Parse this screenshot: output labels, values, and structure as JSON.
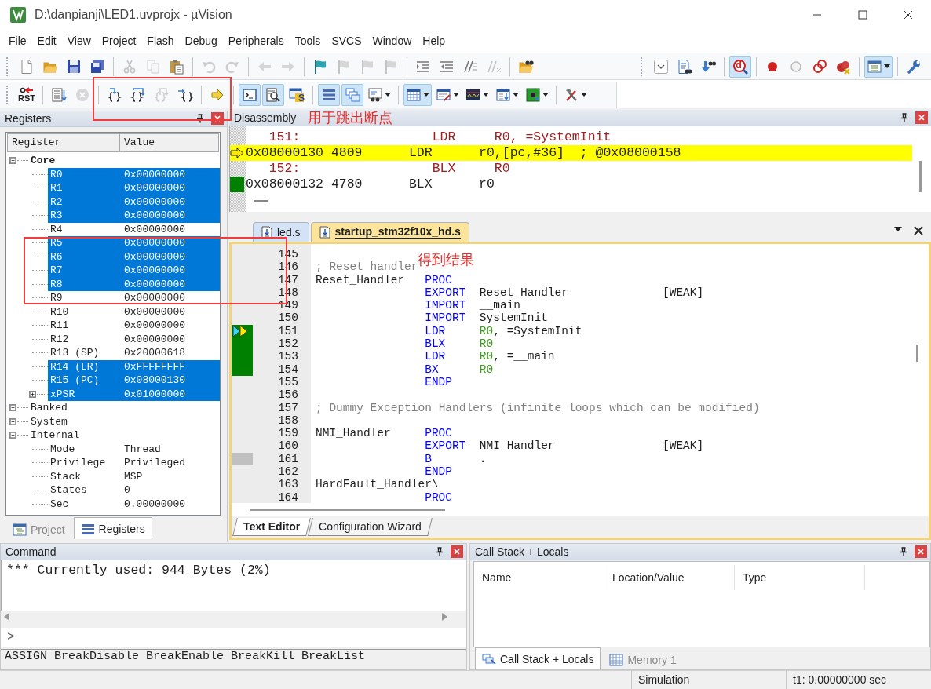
{
  "window": {
    "title": "D:\\danpianji\\LED1.uvprojx - µVision"
  },
  "menu": [
    "File",
    "Edit",
    "View",
    "Project",
    "Flash",
    "Debug",
    "Peripherals",
    "Tools",
    "SVCS",
    "Window",
    "Help"
  ],
  "toolbar_rows": [
    [
      {
        "groups": [
          [
            {
              "disabled": false,
              "pressed": false
            },
            {
              "disabled": false,
              "pressed": false
            },
            {
              "disabled": false,
              "pressed": false
            },
            {
              "disabled": false,
              "pressed": false
            }
          ],
          [
            {
              "disabled": true,
              "pressed": false
            },
            {
              "disabled": true,
              "pressed": false
            },
            {
              "disabled": false,
              "pressed": false
            }
          ],
          [
            {
              "disabled": true,
              "pressed": false
            },
            {
              "disabled": true,
              "pressed": false
            }
          ],
          [
            {
              "disabled": true,
              "pressed": false
            },
            {
              "disabled": true,
              "pressed": false
            }
          ],
          [
            {
              "disabled": false,
              "pressed": false
            },
            {
              "disabled": true,
              "pressed": false
            },
            {
              "disabled": true,
              "pressed": false
            },
            {
              "disabled": true,
              "pressed": false
            }
          ],
          [
            {
              "disabled": false,
              "pressed": false
            },
            {
              "disabled": false,
              "pressed": false
            },
            {
              "disabled": false,
              "pressed": false
            },
            {
              "disabled": true,
              "pressed": false
            }
          ],
          [
            {
              "disabled": false,
              "pressed": false
            }
          ]
        ]
      },
      {
        "groups": [
          [
            {
              "disabled": false,
              "pressed": false
            },
            {
              "disabled": false,
              "pressed": false
            },
            {
              "disabled": false,
              "pressed": false
            }
          ],
          [
            {
              "disabled": false,
              "pressed": true,
              "label": "d"
            }
          ],
          [
            {
              "disabled": false,
              "pressed": false
            },
            {
              "disabled": false,
              "pressed": false
            },
            {
              "disabled": false,
              "pressed": false
            },
            {
              "disabled": false,
              "pressed": false
            }
          ],
          [
            {
              "disabled": false,
              "pressed": true
            }
          ],
          [
            {
              "disabled": false,
              "pressed": false
            }
          ]
        ]
      }
    ],
    [
      {
        "groups": [
          [
            {
              "disabled": false,
              "pressed": false,
              "label": "RST"
            }
          ],
          [
            {
              "disabled": false,
              "pressed": false
            },
            {
              "disabled": true,
              "pressed": false
            }
          ],
          [
            {
              "disabled": false,
              "pressed": false
            },
            {
              "disabled": false,
              "pressed": false
            },
            {
              "disabled": true,
              "pressed": false
            },
            {
              "disabled": false,
              "pressed": false
            }
          ],
          [
            {
              "disabled": false,
              "pressed": false
            }
          ],
          [
            {
              "disabled": false,
              "pressed": true
            },
            {
              "disabled": false,
              "pressed": true
            },
            {
              "disabled": false,
              "pressed": false,
              "label": "S"
            }
          ],
          [
            {
              "disabled": false,
              "pressed": true
            },
            {
              "disabled": false,
              "pressed": true
            },
            {
              "disabled": false,
              "pressed": false
            }
          ],
          [
            {
              "disabled": false,
              "pressed": true
            },
            {
              "disabled": false,
              "pressed": false
            },
            {
              "disabled": false,
              "pressed": false
            },
            {
              "disabled": false,
              "pressed": false
            },
            {
              "disabled": false,
              "pressed": false
            }
          ],
          [
            {
              "disabled": false,
              "pressed": false
            }
          ]
        ]
      }
    ]
  ],
  "registers": {
    "title": "Registers",
    "columns": [
      "Register",
      "Value"
    ],
    "tree": [
      {
        "name": "Core",
        "bold": true,
        "expanded": true,
        "selected": false,
        "children": [
          {
            "name": "R0",
            "value": "0x00000000",
            "selected": true
          },
          {
            "name": "R1",
            "value": "0x00000000",
            "selected": true
          },
          {
            "name": "R2",
            "value": "0x00000000",
            "selected": true
          },
          {
            "name": "R3",
            "value": "0x00000000",
            "selected": true
          },
          {
            "name": "R4",
            "value": "0x00000000",
            "selected": false
          },
          {
            "name": "R5",
            "value": "0x00000000",
            "selected": true
          },
          {
            "name": "R6",
            "value": "0x00000000",
            "selected": true
          },
          {
            "name": "R7",
            "value": "0x00000000",
            "selected": true
          },
          {
            "name": "R8",
            "value": "0x00000000",
            "selected": true
          },
          {
            "name": "R9",
            "value": "0x00000000",
            "selected": false
          },
          {
            "name": "R10",
            "value": "0x00000000",
            "selected": false
          },
          {
            "name": "R11",
            "value": "0x00000000",
            "selected": false
          },
          {
            "name": "R12",
            "value": "0x00000000",
            "selected": false
          },
          {
            "name": "R13 (SP)",
            "value": "0x20000618",
            "selected": false
          },
          {
            "name": "R14 (LR)",
            "value": "0xFFFFFFFF",
            "selected": true
          },
          {
            "name": "R15 (PC)",
            "value": "0x08000130",
            "selected": true
          },
          {
            "name": "xPSR",
            "value": "0x01000000",
            "selected": true,
            "expanded": false
          }
        ]
      },
      {
        "name": "Banked",
        "bold": false,
        "expanded": false,
        "selected": false
      },
      {
        "name": "System",
        "bold": false,
        "expanded": false,
        "selected": false
      },
      {
        "name": "Internal",
        "bold": false,
        "expanded": true,
        "selected": false,
        "children": [
          {
            "name": "Mode",
            "value": "Thread",
            "selected": false
          },
          {
            "name": "Privilege",
            "value": "Privileged",
            "selected": false
          },
          {
            "name": "Stack",
            "value": "MSP",
            "selected": false
          },
          {
            "name": "States",
            "value": "0",
            "selected": false
          },
          {
            "name": "Sec",
            "value": "0.00000000",
            "selected": false
          }
        ]
      }
    ],
    "tabs": [
      {
        "label": "Project",
        "selected": false
      },
      {
        "label": "Registers",
        "selected": true
      }
    ]
  },
  "disassembly": {
    "title": "Disassembly",
    "lines": [
      {
        "kind": "source",
        "label": "151:",
        "mnemonic": "LDR",
        "operands": "R0, =SystemInit"
      },
      {
        "kind": "asm",
        "address": "0x08000130",
        "opcode": "4809",
        "mnemonic": "LDR",
        "operands": "r0,[pc,#36]",
        "comment": "; @0x08000158",
        "current": true
      },
      {
        "kind": "source",
        "label": "152:",
        "mnemonic": "BLX",
        "operands": "R0"
      },
      {
        "kind": "asm",
        "address": "0x08000132",
        "opcode": "4780",
        "mnemonic": "BLX",
        "operands": "r0",
        "current": false
      }
    ]
  },
  "editor": {
    "tabs": [
      {
        "label": "led.s",
        "selected": false
      },
      {
        "label": "startup_stm32f10x_hd.s",
        "selected": true
      }
    ],
    "lines": [
      {
        "number": "145"
      },
      {
        "number": "146",
        "comment": "; Reset handler"
      },
      {
        "number": "147",
        "label": "Reset_Handler",
        "op": "PROC"
      },
      {
        "number": "148",
        "op": "EXPORT",
        "args": [
          {
            "kind": "plain",
            "text": "Reset_Handler"
          }
        ],
        "attr": "[WEAK]"
      },
      {
        "number": "149",
        "op": "IMPORT",
        "args": [
          {
            "kind": "plain",
            "text": "__main"
          }
        ]
      },
      {
        "number": "150",
        "op": "IMPORT",
        "args": [
          {
            "kind": "plain",
            "text": "SystemInit"
          }
        ]
      },
      {
        "number": "151",
        "current": true,
        "executed": true,
        "op": "LDR",
        "args": [
          {
            "kind": "register",
            "text": "R0"
          },
          {
            "kind": "plain",
            "text": ", =SystemInit"
          }
        ]
      },
      {
        "number": "152",
        "executed": true,
        "op": "BLX",
        "args": [
          {
            "kind": "register",
            "text": "R0"
          }
        ]
      },
      {
        "number": "153",
        "executed": true,
        "op": "LDR",
        "args": [
          {
            "kind": "register",
            "text": "R0"
          },
          {
            "kind": "plain",
            "text": ", =__main"
          }
        ]
      },
      {
        "number": "154",
        "executed": true,
        "op": "BX",
        "args": [
          {
            "kind": "register",
            "text": "R0"
          }
        ]
      },
      {
        "number": "155",
        "op": "ENDP"
      },
      {
        "number": "156"
      },
      {
        "number": "157",
        "comment": "; Dummy Exception Handlers (infinite loops which can be modified)"
      },
      {
        "number": "158"
      },
      {
        "number": "159",
        "label": "NMI_Handler",
        "op": "PROC"
      },
      {
        "number": "160",
        "op": "EXPORT",
        "args": [
          {
            "kind": "plain",
            "text": "NMI_Handler"
          }
        ],
        "attr": "[WEAK]"
      },
      {
        "number": "161",
        "executed": false,
        "op": "B",
        "args": [
          {
            "kind": "plain",
            "text": "."
          }
        ]
      },
      {
        "number": "162",
        "op": "ENDP"
      },
      {
        "number": "163",
        "label": "HardFault_Handler\\"
      },
      {
        "number": "164",
        "op": "PROC"
      }
    ],
    "bottom_tabs": [
      {
        "label": "Text Editor",
        "selected": true
      },
      {
        "label": "Configuration Wizard",
        "selected": false
      }
    ]
  },
  "command": {
    "title": "Command",
    "output": [
      "*** Currently used: 944 Bytes (2%)"
    ],
    "prompt": ">",
    "hint": "ASSIGN BreakDisable BreakEnable BreakKill BreakList"
  },
  "call_stack": {
    "title": "Call Stack + Locals",
    "columns": [
      "Name",
      "Location/Value",
      "Type"
    ],
    "tabs": [
      {
        "label": "Call Stack + Locals",
        "selected": true
      },
      {
        "label": "Memory 1",
        "selected": false
      }
    ]
  },
  "status_bar": [
    "Simulation",
    "t1: 0.00000000 sec"
  ],
  "annotations": [
    {
      "text": "用于跳出断点"
    },
    {
      "text": "得到结果"
    }
  ]
}
